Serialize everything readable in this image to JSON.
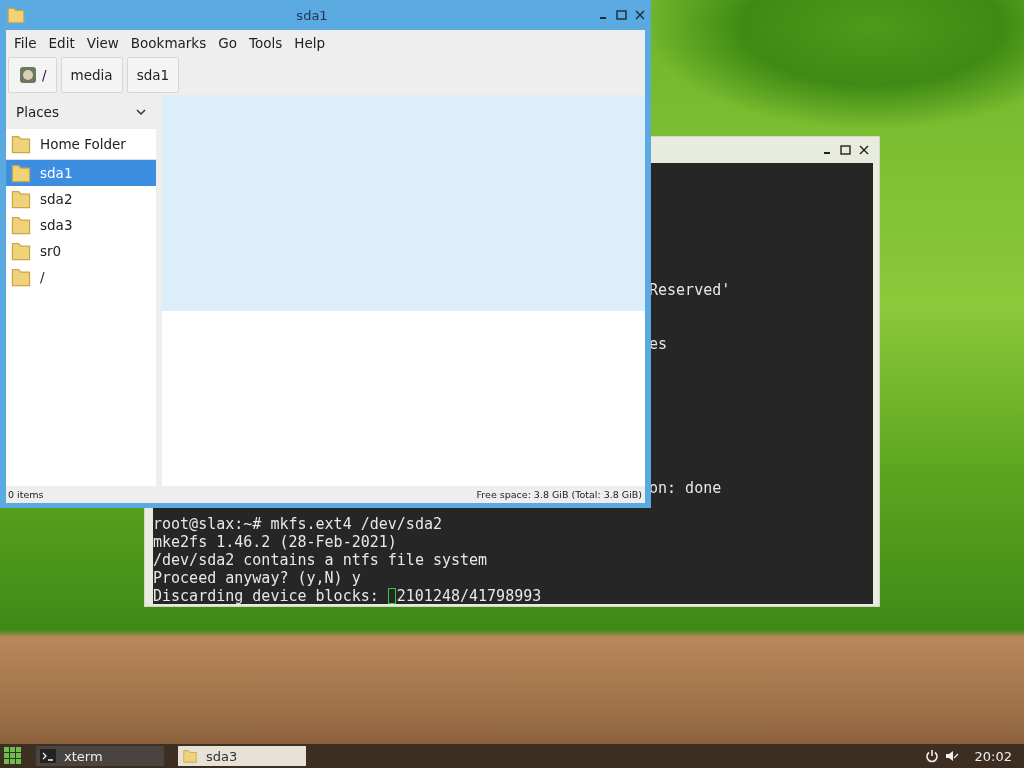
{
  "file_manager": {
    "title": "sda1",
    "menu": [
      "File",
      "Edit",
      "View",
      "Bookmarks",
      "Go",
      "Tools",
      "Help"
    ],
    "path": [
      {
        "label": "/",
        "kind": "root"
      },
      {
        "label": "media",
        "kind": "folder"
      },
      {
        "label": "sda1",
        "kind": "folder"
      }
    ],
    "places": {
      "title": "Places",
      "expanded": true,
      "items": [
        {
          "label": "Home Folder",
          "selected": false
        },
        {
          "label": "sda1",
          "selected": true
        },
        {
          "label": "sda2",
          "selected": false
        },
        {
          "label": "sda3",
          "selected": false
        },
        {
          "label": "sr0",
          "selected": false
        },
        {
          "label": "/",
          "selected": false
        }
      ]
    },
    "status_bar": {
      "items": "0 items",
      "free_space": "Free space: 3.8 GiB (Total: 3.8 GiB)"
    }
  },
  "terminal": {
    "lines": [
      {
        "kind": "covered"
      },
      {
        "kind": "covered"
      },
      {
        "kind": "covered"
      },
      {
        "kind": "covered"
      },
      {
        "kind": "covered"
      },
      {
        "kind": "covered"
      },
      {
        "kind": "partial",
        "text": "Reserved'"
      },
      {
        "kind": "covered"
      },
      {
        "kind": "covered"
      },
      {
        "kind": "partial",
        "text": "es"
      },
      {
        "kind": "covered"
      },
      {
        "kind": "covered"
      },
      {
        "kind": "covered"
      },
      {
        "kind": "covered"
      },
      {
        "kind": "covered"
      },
      {
        "kind": "covered"
      },
      {
        "kind": "covered"
      },
      {
        "kind": "partial",
        "text": "on: done"
      },
      {
        "kind": "covered"
      },
      {
        "kind": "full",
        "text": "root@slax:~# mkfs.ext4 /dev/sda2"
      },
      {
        "kind": "full",
        "text": "mke2fs 1.46.2 (28-Feb-2021)"
      },
      {
        "kind": "full",
        "text": "/dev/sda2 contains a ntfs file system"
      },
      {
        "kind": "full",
        "text": "Proceed anyway? (y,N) y"
      },
      {
        "kind": "full",
        "text": "Discarding device blocks:",
        "cursor": true,
        "after_cursor": "2101248/41798993"
      }
    ]
  },
  "taskbar": {
    "tasks": [
      {
        "label": "xterm",
        "kind": "terminal",
        "selected": false
      },
      {
        "label": "sda3",
        "kind": "folder",
        "selected": true
      }
    ],
    "clock": "20:02"
  }
}
